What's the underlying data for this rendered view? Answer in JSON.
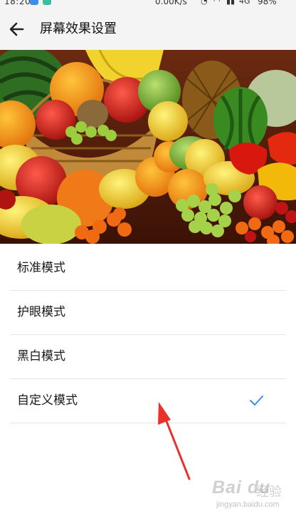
{
  "status_bar": {
    "time": "18:20",
    "network_speed": "0.00K/s",
    "signal": "4G",
    "battery": "98%"
  },
  "header": {
    "back_icon": "arrow-left-icon",
    "title": "屏幕效果设置"
  },
  "banner": {
    "description_icon": "fruit-basket-image"
  },
  "modes": [
    {
      "label": "标准模式",
      "selected": false
    },
    {
      "label": "护眼模式",
      "selected": false
    },
    {
      "label": "黑白模式",
      "selected": false
    },
    {
      "label": "自定义模式",
      "selected": true
    }
  ],
  "colors": {
    "accent": "#3a8ee6",
    "annotation": "#e8312a"
  },
  "watermark": {
    "logo": "Bai du",
    "cn": "经验",
    "url": "jingyan.baidu.com"
  }
}
